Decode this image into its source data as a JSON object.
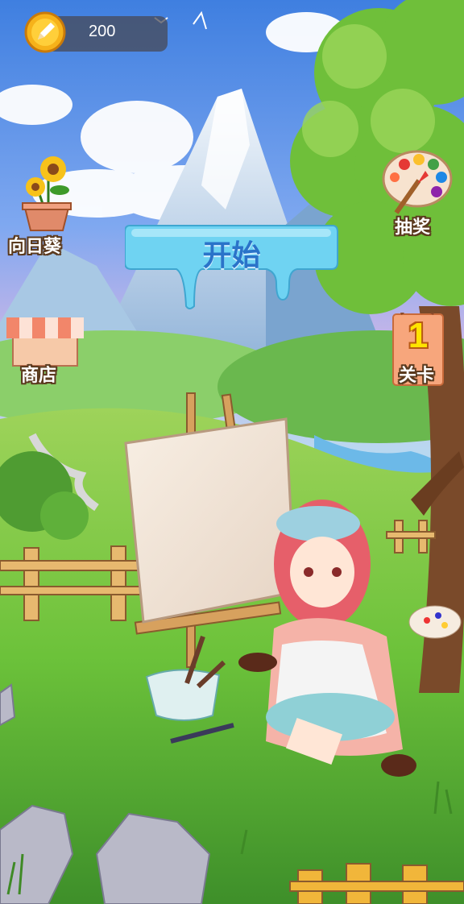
{
  "hud": {
    "coins": "200"
  },
  "menu": {
    "start_label": "开始",
    "sunflower_label": "向日葵",
    "shop_label": "商店",
    "lottery_label": "抽奖",
    "level_label": "关卡",
    "level_number": "1"
  },
  "icons": {
    "coin": "coin-pencil-icon",
    "sunflower": "sunflower-pot-icon",
    "shop": "shop-awning-icon",
    "lottery": "paint-palette-icon"
  },
  "colors": {
    "start_button": "#6fd3f2",
    "start_text": "#2a73c9",
    "coin_gold": "#f6b21a",
    "level_number": "#ffe400"
  }
}
